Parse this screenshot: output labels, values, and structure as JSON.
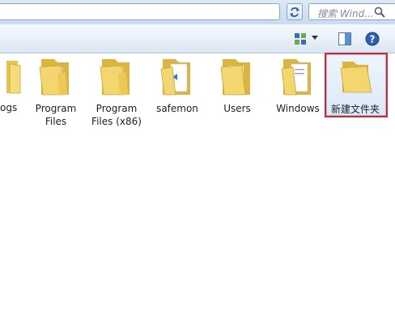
{
  "search": {
    "placeholder": "搜索 Wind..."
  },
  "files": [
    {
      "label": "ogs"
    },
    {
      "label": "Program\nFiles"
    },
    {
      "label": "Program\nFiles (x86)"
    },
    {
      "label": "safemon"
    },
    {
      "label": "Users"
    },
    {
      "label": "Windows"
    },
    {
      "label": "新建文件夹"
    }
  ],
  "colors": {
    "folder": "#f2d66b",
    "selection_outline": "#d9252b",
    "accent": "#2b5aa3"
  }
}
